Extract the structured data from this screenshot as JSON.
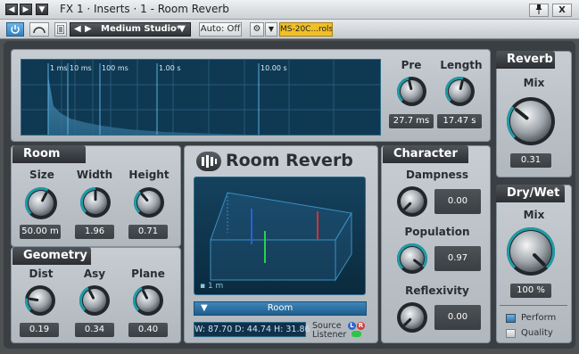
{
  "window": {
    "title": "FX 1 · Inserts · 1 - Room Reverb",
    "nav_left": "◀",
    "nav_right": "▶",
    "nav_menu": "▼",
    "pin": "📌",
    "close": "X"
  },
  "toolbar": {
    "power": "⏻",
    "compare": "⌒",
    "preset_prev": "◀",
    "preset_next": "▶",
    "preset_name": "Medium Studio*",
    "preset_menu": "▼",
    "auto_label": "Auto: Off",
    "settings": "⚙",
    "settings_menu": "▼",
    "controller_label": "MS-20C...rols"
  },
  "analyzer": {
    "time_labels": [
      "1 ms",
      "10 ms",
      "100 ms",
      "1.00 s",
      "10.00 s"
    ]
  },
  "pre": {
    "label": "Pre",
    "value": "27.7 ms",
    "level": 0.45
  },
  "length": {
    "label": "Length",
    "value": "17.47 s",
    "level": 0.55
  },
  "reverb": {
    "tab": "Reverb",
    "mix_label": "Mix",
    "mix_value": "0.31",
    "mix_level": 0.31
  },
  "room": {
    "tab": "Room",
    "size": {
      "label": "Size",
      "value": "50.00 m",
      "level": 0.6
    },
    "width": {
      "label": "Width",
      "value": "1.96",
      "level": 0.5
    },
    "height": {
      "label": "Height",
      "value": "0.71",
      "level": 0.35
    }
  },
  "geometry": {
    "tab": "Geometry",
    "dist": {
      "label": "Dist",
      "value": "0.19",
      "level": 0.2
    },
    "asy": {
      "label": "Asy",
      "value": "0.34",
      "level": 0.4
    },
    "plane": {
      "label": "Plane",
      "value": "0.40",
      "level": 0.4
    }
  },
  "center": {
    "brand_title": "Room Reverb",
    "scale_label": "1 m",
    "room_select": "Room",
    "room_select_arrow": "▼",
    "dimensions": "W: 87.70  D: 44.74  H: 31.86",
    "source_label": "Source",
    "listener_label": "Listener",
    "source_l": "L",
    "source_r": "R"
  },
  "character": {
    "tab": "Character",
    "dampness": {
      "label": "Dampness",
      "value": "0.00",
      "level": 0.0
    },
    "population": {
      "label": "Population",
      "value": "0.97",
      "level": 0.97
    },
    "reflexivity": {
      "label": "Reflexivity",
      "value": "0.00",
      "level": 0.0
    }
  },
  "drywet": {
    "tab": "Dry/Wet",
    "mix_label": "Mix",
    "mix_value": "100 %",
    "mix_level": 1.0,
    "perform_label": "Perform",
    "quality_label": "Quality"
  },
  "colors": {
    "accent_blue": "#4a9cd6",
    "analyzer_bg": "#0f3852",
    "controller_yellow": "#f0c028",
    "knob_arc": "#1f9aa6"
  }
}
